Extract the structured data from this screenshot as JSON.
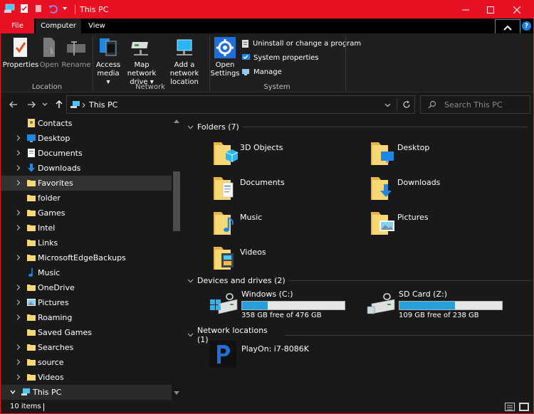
{
  "window": {
    "title": "This PC",
    "accent_color": "#e81123"
  },
  "tabs": {
    "file": "File",
    "computer": "Computer",
    "view": "View"
  },
  "help": "?",
  "ribbon": {
    "properties": "Properties",
    "open": "Open",
    "rename": "Rename",
    "access_media": [
      "Access",
      "media ▾"
    ],
    "map_network_drive": [
      "Map network",
      "drive ▾"
    ],
    "add_network_location": [
      "Add a network",
      "location"
    ],
    "open_settings": [
      "Open",
      "Settings"
    ],
    "uninstall": "Uninstall or change a program",
    "system_properties": "System properties",
    "manage": "Manage",
    "groups": {
      "location": "Location",
      "network": "Network",
      "system": "System"
    }
  },
  "address": {
    "path": "This PC",
    "search_placeholder": "Search This PC"
  },
  "nav_tree": [
    {
      "label": "Contacts",
      "icon": "contacts-icon",
      "expandable": false
    },
    {
      "label": "Desktop",
      "icon": "desktop-folder-icon",
      "expandable": true
    },
    {
      "label": "Documents",
      "icon": "documents-icon",
      "expandable": true
    },
    {
      "label": "Downloads",
      "icon": "downloads-icon",
      "expandable": true
    },
    {
      "label": "Favorites",
      "icon": "folder-icon",
      "expandable": true,
      "selected": true
    },
    {
      "label": "folder",
      "icon": "folder-icon",
      "expandable": false
    },
    {
      "label": "Games",
      "icon": "folder-icon",
      "expandable": true
    },
    {
      "label": "Intel",
      "icon": "folder-icon",
      "expandable": true
    },
    {
      "label": "Links",
      "icon": "folder-icon",
      "expandable": false
    },
    {
      "label": "MicrosoftEdgeBackups",
      "icon": "folder-icon",
      "expandable": true
    },
    {
      "label": "Music",
      "icon": "music-icon",
      "expandable": false
    },
    {
      "label": "OneDrive",
      "icon": "folder-icon",
      "expandable": true
    },
    {
      "label": "Pictures",
      "icon": "pictures-icon",
      "expandable": true
    },
    {
      "label": "Roaming",
      "icon": "folder-icon",
      "expandable": true
    },
    {
      "label": "Saved Games",
      "icon": "folder-icon",
      "expandable": false
    },
    {
      "label": "Searches",
      "icon": "folder-icon",
      "expandable": true
    },
    {
      "label": "source",
      "icon": "folder-icon",
      "expandable": true
    },
    {
      "label": "Videos",
      "icon": "folder-icon",
      "expandable": true
    },
    {
      "label": "This PC",
      "icon": "this-pc-icon",
      "expanded": true,
      "highlighted": true
    }
  ],
  "content": {
    "folders_header": "Folders (7)",
    "folders": [
      {
        "name": "3D Objects",
        "icon": "3d-objects-icon"
      },
      {
        "name": "Desktop",
        "icon": "desktop-folder-icon"
      },
      {
        "name": "Documents",
        "icon": "documents-folder-icon"
      },
      {
        "name": "Downloads",
        "icon": "downloads-folder-icon"
      },
      {
        "name": "Music",
        "icon": "music-folder-icon"
      },
      {
        "name": "Pictures",
        "icon": "pictures-folder-icon"
      },
      {
        "name": "Videos",
        "icon": "videos-folder-icon"
      }
    ],
    "drives_header": "Devices and drives (2)",
    "drives": [
      {
        "name": "Windows (C:)",
        "free": "358 GB free of 476 GB",
        "used_fraction": 0.248
      },
      {
        "name": "SD Card (Z:)",
        "free": "109 GB free of 238 GB",
        "used_fraction": 0.542
      }
    ],
    "network_header": "Network locations (1)",
    "network": [
      {
        "name": "PlayOn: i7-8086K",
        "icon": "playon-icon"
      }
    ]
  },
  "status": {
    "items": "10 items"
  }
}
